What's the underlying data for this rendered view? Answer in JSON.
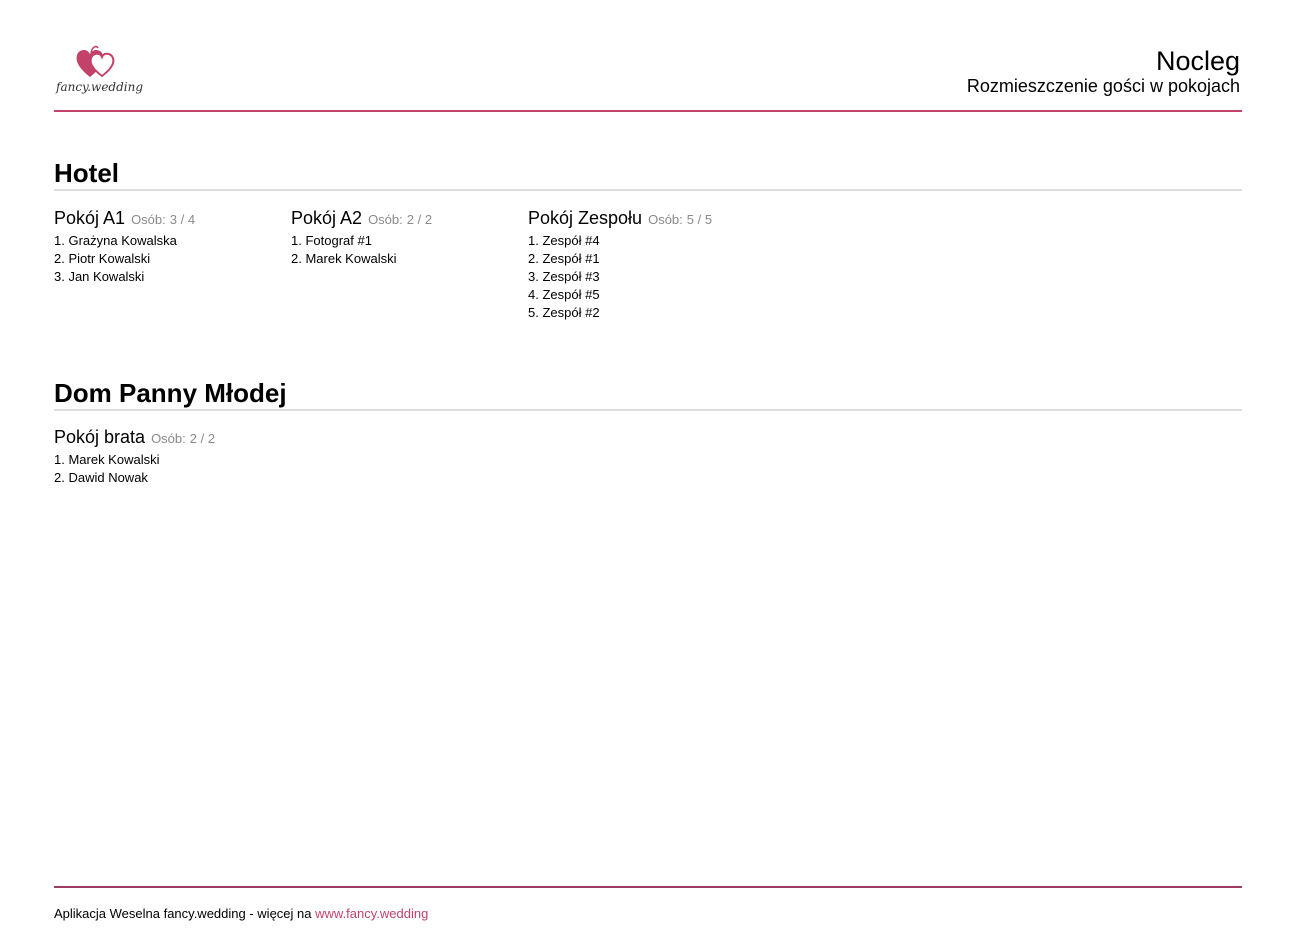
{
  "header": {
    "logo_text": "fancy.wedding",
    "title": "Nocleg",
    "subtitle": "Rozmieszczenie gości w pokojach"
  },
  "colors": {
    "accent": "#c2426a",
    "divider": "#dddddd",
    "muted_text": "#8a8a8a"
  },
  "icons": {
    "logo": "two-hearts-icon"
  },
  "sections": [
    {
      "title": "Hotel",
      "rooms": [
        {
          "name": "Pokój A1",
          "count_label": "Osób:",
          "count": "3 / 4",
          "guests": [
            "1. Grażyna Kowalska",
            "2. Piotr Kowalski",
            "3. Jan Kowalski"
          ]
        },
        {
          "name": "Pokój A2",
          "count_label": "Osób:",
          "count": "2 / 2",
          "guests": [
            "1. Fotograf #1",
            "2. Marek Kowalski"
          ]
        },
        {
          "name": "Pokój Zespołu",
          "count_label": "Osób:",
          "count": "5 / 5",
          "guests": [
            "1. Zespół #4",
            "2. Zespół #1",
            "3. Zespół #3",
            "4. Zespół #5",
            "5. Zespół #2"
          ]
        }
      ]
    },
    {
      "title": "Dom Panny Młodej",
      "rooms": [
        {
          "name": "Pokój brata",
          "count_label": "Osób:",
          "count": "2 / 2",
          "guests": [
            "1. Marek Kowalski",
            "2. Dawid Nowak"
          ]
        }
      ]
    }
  ],
  "footer": {
    "text": "Aplikacja Weselna fancy.wedding - więcej na",
    "link": "www.fancy.wedding"
  }
}
